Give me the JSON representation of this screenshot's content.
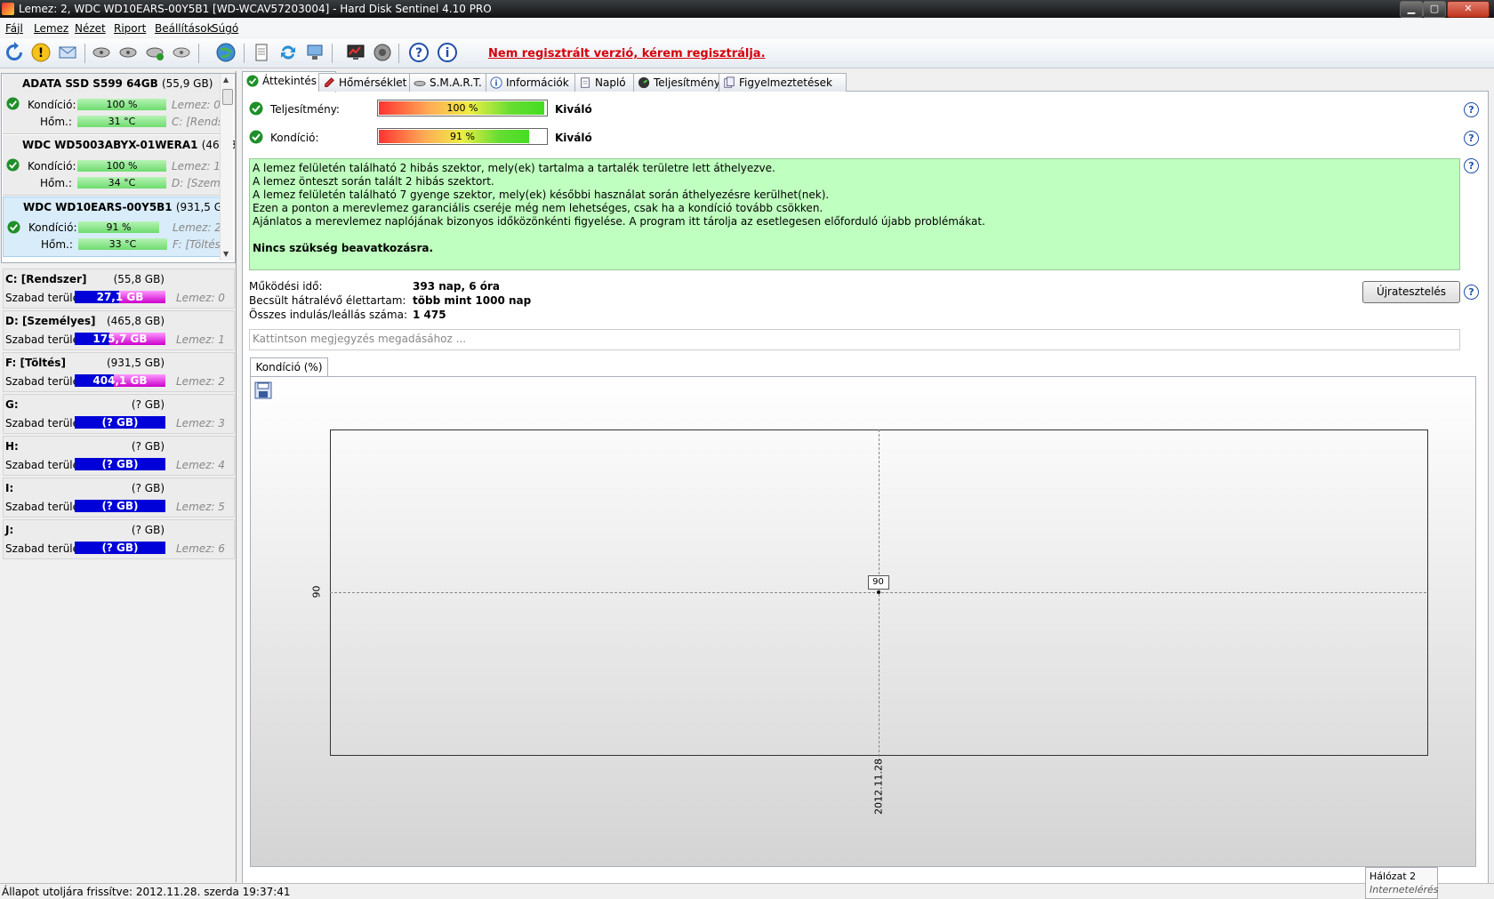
{
  "window": {
    "title": "Lemez: 2, WDC WD10EARS-00Y5B1 [WD-WCAV57203004]  -  Hard Disk Sentinel 4.10 PRO",
    "min_label": "▁",
    "max_label": "▢",
    "close_label": "✕"
  },
  "menu": [
    "Fájl",
    "Lemez",
    "Nézet",
    "Riport",
    "Beállítások",
    "Súgó"
  ],
  "toolbar": {
    "icons": [
      "refresh-icon",
      "warning-icon",
      "mail-icon",
      "disk-icon",
      "disk-add-icon",
      "disk-check-icon",
      "disk-remove-icon",
      "globe-icon",
      "report-icon",
      "sync-icon",
      "network-icon",
      "screen-chart-icon",
      "speaker-icon",
      "help-icon",
      "info-icon"
    ],
    "register_link": "Nem regisztrált verzió, kérem regisztrálja."
  },
  "disks": [
    {
      "name": "ADATA SSD S599 64GB",
      "size": "(55,9 GB)",
      "cond_label": "Kondíció:",
      "cond_value": "100 %",
      "cond_pct": 100,
      "cond_meta": "Lemez: 0",
      "temp_label": "Hőm.:",
      "temp_value": "31 °C",
      "temp_meta": "C: [Rendsz"
    },
    {
      "name": "WDC WD5003ABYX-01WERA1",
      "size": "(465,8 GE",
      "cond_label": "Kondíció:",
      "cond_value": "100 %",
      "cond_pct": 100,
      "cond_meta": "Lemez: 1",
      "temp_label": "Hőm.:",
      "temp_value": "34 °C",
      "temp_meta": "D: [Szemé"
    },
    {
      "name": "WDC WD10EARS-00Y5B1",
      "size": "(931,5 GB)",
      "cond_label": "Kondíció:",
      "cond_value": "91 %",
      "cond_pct": 91,
      "cond_meta": "Lemez: 2",
      "temp_label": "Hőm.:",
      "temp_value": "33 °C",
      "temp_meta": "F: [Töltés]"
    }
  ],
  "partitions": [
    {
      "name": "C: [Rendszer]",
      "size": "(55,8 GB)",
      "free_label": "Szabad terület",
      "free": "27,1 GB",
      "free_fraction": 0.49,
      "disk": "Lemez: 0"
    },
    {
      "name": "D: [Személyes]",
      "size": "(465,8 GB)",
      "free_label": "Szabad terület",
      "free": "175,7 GB",
      "free_fraction": 0.38,
      "disk": "Lemez: 1"
    },
    {
      "name": "F: [Töltés]",
      "size": "(931,5 GB)",
      "free_label": "Szabad terület",
      "free": "404,1 GB",
      "free_fraction": 0.43,
      "disk": "Lemez: 2"
    },
    {
      "name": "G:",
      "size": "(? GB)",
      "free_label": "Szabad terület",
      "free": "(? GB)",
      "free_fraction": 1,
      "disk": "Lemez: 3"
    },
    {
      "name": "H:",
      "size": "(? GB)",
      "free_label": "Szabad terület",
      "free": "(? GB)",
      "free_fraction": 1,
      "disk": "Lemez: 4"
    },
    {
      "name": "I:",
      "size": "(? GB)",
      "free_label": "Szabad terület",
      "free": "(? GB)",
      "free_fraction": 1,
      "disk": "Lemez: 5"
    },
    {
      "name": "J:",
      "size": "(? GB)",
      "free_label": "Szabad terület",
      "free": "(? GB)",
      "free_fraction": 1,
      "disk": "Lemez: 6"
    }
  ],
  "tabs": [
    {
      "label": "Áttekintés",
      "icon": "check-icon",
      "active": true
    },
    {
      "label": "Hőmérséklet",
      "icon": "thermometer-icon"
    },
    {
      "label": "S.M.A.R.T.",
      "icon": "smart-icon"
    },
    {
      "label": "Információk",
      "icon": "info-icon"
    },
    {
      "label": "Napló",
      "icon": "log-icon"
    },
    {
      "label": "Teljesítmény",
      "icon": "performance-icon"
    },
    {
      "label": "Figyelmeztetések",
      "icon": "alerts-icon"
    }
  ],
  "overview": {
    "perf_label": "Teljesítmény:",
    "perf_value": "100 %",
    "perf_pct": 100,
    "perf_rating": "Kiváló",
    "cond_label": "Kondíció:",
    "cond_value": "91 %",
    "cond_pct": 91,
    "cond_rating": "Kiváló",
    "help": "?",
    "messages": [
      "A lemez felületén található 2 hibás szektor, mely(ek) tartalma a tartalék területre lett áthelyezve.",
      "A lemez önteszt során talált 2 hibás szektort.",
      "A lemez felületén található 7 gyenge szektor, mely(ek) későbbi használat során áthelyezésre kerülhet(nek).",
      "Ezen a ponton a merevlemez garanciális cseréje még nem lehetséges, csak ha a kondíció tovább csökken.",
      "Ajánlatos a merevlemez naplójának bizonyos időközönkénti figyelése. A program itt tárolja az esetlegesen előforduló újabb problémákat."
    ],
    "conclusion": "Nincs szükség beavatkozásra.",
    "stats": [
      {
        "label": "Működési idő:",
        "value": "393 nap, 6 óra"
      },
      {
        "label": "Becsült hátralévő élettartam:",
        "value": "több mint 1000 nap"
      },
      {
        "label": "Összes indulás/leállás száma:",
        "value": "1 475"
      }
    ],
    "retest_label": "Újratesztelés",
    "note_placeholder": "Kattintson megjegyzés megadásához ..."
  },
  "chart_tab_label": "Kondíció  (%)",
  "chart_data": {
    "type": "line",
    "x": [
      "2012.11.28"
    ],
    "series": [
      {
        "values": [
          90
        ]
      }
    ],
    "y_ticks": [
      90
    ],
    "x_ticks": [
      "2012.11.28"
    ],
    "data_labels": [
      "90"
    ],
    "grid": true
  },
  "status": {
    "text": "Állapot utoljára frissítve: 2012.11.28. szerda 19:37:41",
    "net_title": "Hálózat  2",
    "net_sub": "Internetelérés"
  }
}
